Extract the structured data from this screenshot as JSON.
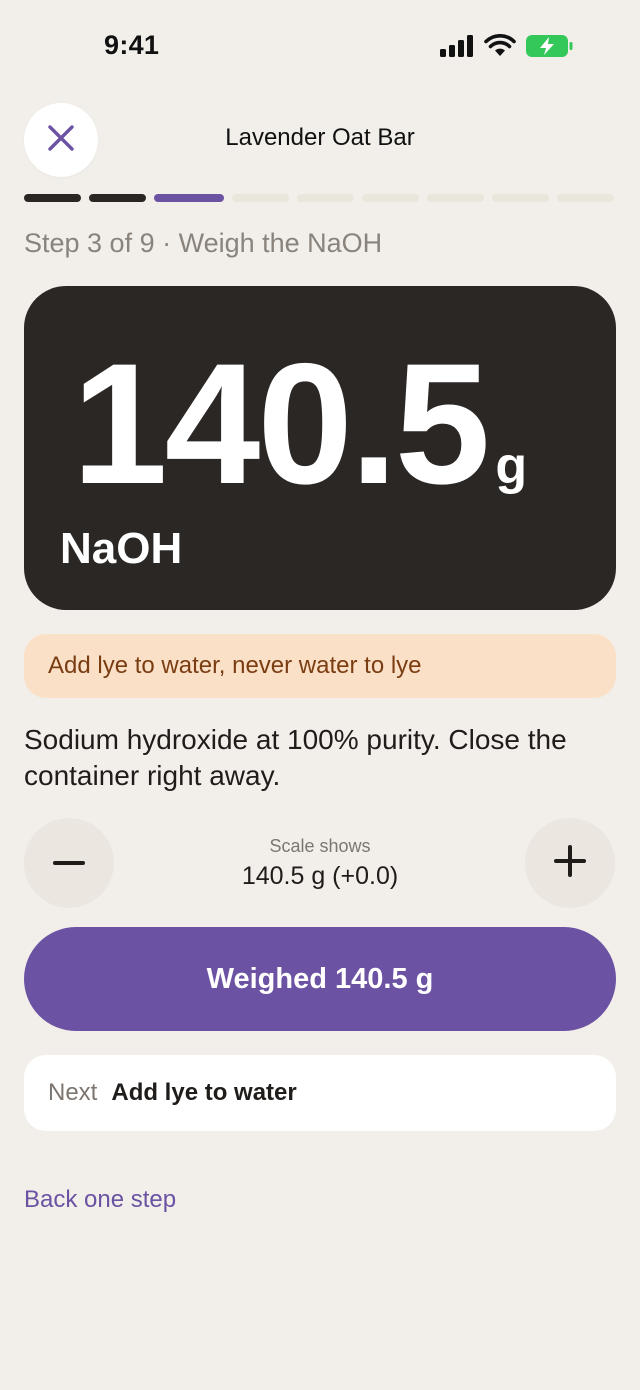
{
  "status_bar": {
    "time": "9:41",
    "icons": [
      "cellular-signal-icon",
      "wifi-icon",
      "battery-charging-icon"
    ]
  },
  "header": {
    "close_icon": "close-icon",
    "title": "Lavender Oat Bar"
  },
  "progress": {
    "total_steps": 9,
    "current_step": 3
  },
  "step_label": "Step 3 of 9 · Weigh the NaOH",
  "display": {
    "value": "140.5",
    "unit": "g",
    "chemical": "NaOH"
  },
  "warning": "Add lye to water, never water to lye",
  "description": "Sodium hydroxide at 100% purity. Close the container right away.",
  "scale": {
    "caption": "Scale shows",
    "value": "140.5 g (+0.0)",
    "minus_icon": "minus-icon",
    "plus_icon": "plus-icon"
  },
  "primary_button": "Weighed 140.5 g",
  "next": {
    "label": "Next",
    "value": "Add lye to water"
  },
  "back_link": "Back one step",
  "colors": {
    "background": "#f2efea",
    "accent": "#6b52a3",
    "display_bg": "#2b2725",
    "warning_bg": "#fbe0c8",
    "warning_text": "#7a3d12",
    "battery": "#34c759"
  }
}
